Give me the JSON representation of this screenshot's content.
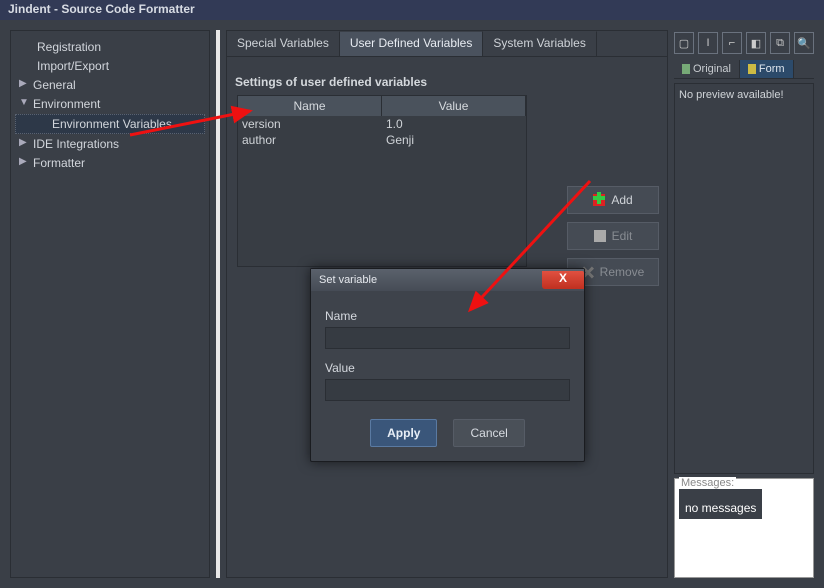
{
  "window": {
    "title": "Jindent - Source Code Formatter"
  },
  "tree": {
    "registration": "Registration",
    "import_export": "Import/Export",
    "general": "General",
    "environment": "Environment",
    "env_vars": "Environment Variables",
    "ide": "IDE Integrations",
    "formatter": "Formatter"
  },
  "tabs": {
    "special": "Special Variables",
    "user": "User Defined Variables",
    "system": "System Variables"
  },
  "section": {
    "title": "Settings of user defined variables"
  },
  "table": {
    "hdr_name": "Name",
    "hdr_value": "Value",
    "r0_name": "version",
    "r0_val": "1.0",
    "r1_name": "author",
    "r1_val": "Genji"
  },
  "btns": {
    "add": "Add",
    "edit": "Edit",
    "remove": "Remove"
  },
  "right": {
    "original": "Original",
    "form": "Form",
    "no_preview": "No preview available!",
    "messages_label": "Messages:",
    "no_messages": "no messages"
  },
  "modal": {
    "title": "Set variable",
    "name_label": "Name",
    "value_label": "Value",
    "apply": "Apply",
    "cancel": "Cancel"
  }
}
